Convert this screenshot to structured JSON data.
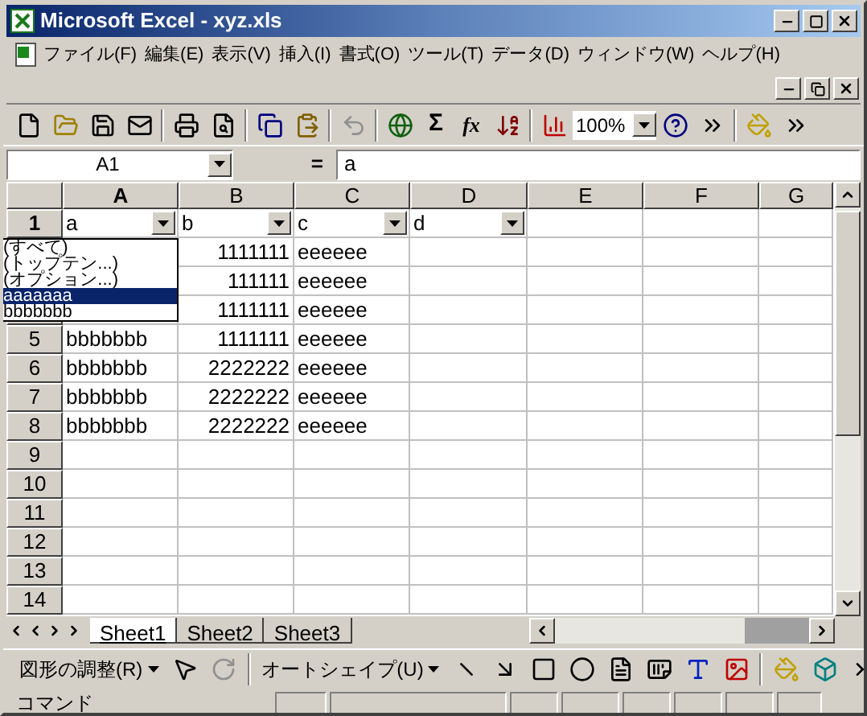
{
  "window": {
    "title": "Microsoft Excel - xyz.xls"
  },
  "menu": [
    "ファイル(F)",
    "編集(E)",
    "表示(V)",
    "挿入(I)",
    "書式(O)",
    "ツール(T)",
    "データ(D)",
    "ウィンドウ(W)",
    "ヘルプ(H)"
  ],
  "toolbar": {
    "sum": "Σ",
    "function": "fx",
    "zoom": "100%"
  },
  "formula_bar": {
    "name_box": "A1",
    "equals": "=",
    "value": "a"
  },
  "columns": [
    {
      "label": "A",
      "selected": true
    },
    {
      "label": "B",
      "selected": false
    },
    {
      "label": "C",
      "selected": false
    },
    {
      "label": "D",
      "selected": false
    },
    {
      "label": "E",
      "selected": false
    },
    {
      "label": "F",
      "selected": false
    },
    {
      "label": "G",
      "selected": false
    }
  ],
  "rows": [
    {
      "label": "1",
      "selected": true,
      "cells": [
        {
          "text": "a",
          "kind": "filter"
        },
        {
          "text": "b",
          "kind": "filter"
        },
        {
          "text": "c",
          "kind": "filter"
        },
        {
          "text": "d",
          "kind": "filter"
        }
      ]
    },
    {
      "cells": [
        null,
        {
          "text": "1111111",
          "kind": "number"
        },
        {
          "text": "eeeeee",
          "kind": "text"
        }
      ]
    },
    {
      "cells": [
        null,
        {
          "text": "111111",
          "kind": "number"
        },
        {
          "text": "eeeeee",
          "kind": "text"
        }
      ]
    },
    {
      "cells": [
        null,
        {
          "text": "1111111",
          "kind": "number"
        },
        {
          "text": "eeeeee",
          "kind": "text"
        }
      ]
    },
    {
      "label": "5",
      "selected": false,
      "cells": [
        {
          "text": "bbbbbbb",
          "kind": "text"
        },
        {
          "text": "1111111",
          "kind": "number"
        },
        {
          "text": "eeeeee",
          "kind": "text"
        }
      ]
    },
    {
      "label": "6",
      "selected": false,
      "cells": [
        {
          "text": "bbbbbbb",
          "kind": "text"
        },
        {
          "text": "2222222",
          "kind": "number"
        },
        {
          "text": "eeeeee",
          "kind": "text"
        }
      ]
    },
    {
      "label": "7",
      "selected": false,
      "cells": [
        {
          "text": "bbbbbbb",
          "kind": "text"
        },
        {
          "text": "2222222",
          "kind": "number"
        },
        {
          "text": "eeeeee",
          "kind": "text"
        }
      ]
    },
    {
      "label": "8",
      "selected": false,
      "cells": [
        {
          "text": "bbbbbbb",
          "kind": "text"
        },
        {
          "text": "2222222",
          "kind": "number"
        },
        {
          "text": "eeeeee",
          "kind": "text"
        }
      ]
    },
    {
      "label": "9",
      "selected": false,
      "cells": []
    },
    {
      "label": "10",
      "selected": false,
      "cells": []
    },
    {
      "label": "11",
      "selected": false,
      "cells": []
    },
    {
      "label": "12",
      "selected": false,
      "cells": []
    },
    {
      "label": "13",
      "selected": false,
      "cells": []
    },
    {
      "label": "14",
      "selected": false,
      "cells": []
    }
  ],
  "filter_list": [
    {
      "text": "(すべて)",
      "selected": false
    },
    {
      "text": "(トップテン...)",
      "selected": false
    },
    {
      "text": "(オプション...)",
      "selected": false
    },
    {
      "text": "aaaaaaa",
      "selected": true
    },
    {
      "text": "bbbbbbb",
      "selected": false
    }
  ],
  "sheet_tabs": [
    {
      "label": "Sheet1",
      "selected": true
    },
    {
      "label": "Sheet2",
      "selected": false
    },
    {
      "label": "Sheet3",
      "selected": false
    }
  ],
  "drawing_toolbar": {
    "adjust": "図形の調整(R)",
    "autoshape": "オートシェイプ(U)"
  },
  "status_bar": {
    "text": "コマンド"
  }
}
